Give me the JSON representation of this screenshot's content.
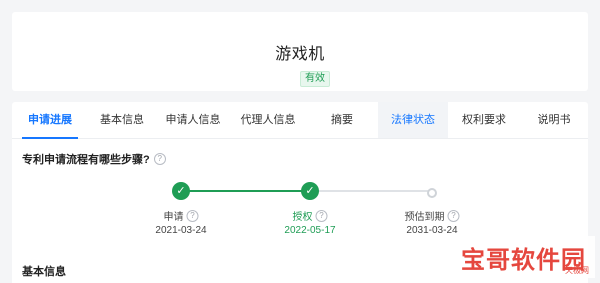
{
  "header": {
    "title": "游戏机",
    "status_badge": "有效"
  },
  "tabs": [
    {
      "label": "申请进展"
    },
    {
      "label": "基本信息"
    },
    {
      "label": "申请人信息"
    },
    {
      "label": "代理人信息"
    },
    {
      "label": "摘要"
    },
    {
      "label": "法律状态"
    },
    {
      "label": "权利要求"
    },
    {
      "label": "说明书"
    }
  ],
  "process": {
    "question": "专利申请流程有哪些步骤?",
    "steps": [
      {
        "label": "申请",
        "date": "2021-03-24"
      },
      {
        "label": "授权",
        "date": "2022-05-17"
      },
      {
        "label": "预估到期",
        "date": "2031-03-24"
      }
    ]
  },
  "sections": {
    "basic_info_title": "基本信息"
  },
  "watermark": {
    "text": "宝哥软件园",
    "sub": "天极网"
  },
  "colors": {
    "accent": "#1677ff",
    "success": "#1f9d55",
    "watermark": "#e5473e"
  }
}
